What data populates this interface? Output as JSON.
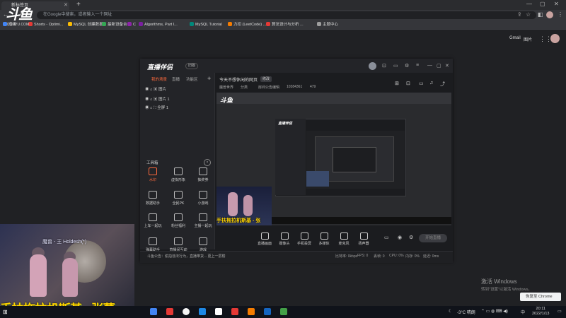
{
  "browser": {
    "tab_title": "新标签页",
    "omnibox_placeholder": "在Google中搜索，或者输入一个网址",
    "bookmarks": [
      {
        "label": "应用",
        "color": "#4285f4"
      },
      {
        "label": "Shorts - Optimi...",
        "color": "#e53935"
      },
      {
        "label": "MySQL 创建数据...",
        "color": "#fbbc04"
      },
      {
        "label": "最新设备台",
        "color": "#34a853"
      },
      {
        "label": "C",
        "color": "#8e24aa"
      },
      {
        "label": "Algorithms, Part I...",
        "color": "#7b1fa2"
      },
      {
        "label": "MySQL Tutorial",
        "color": "#00897b"
      },
      {
        "label": "力扣 (LeetCode) ...",
        "color": "#f57c00"
      },
      {
        "label": "算法设计与分析 ...",
        "color": "#e53935"
      },
      {
        "label": "主题中心",
        "color": "#9e9e9e"
      }
    ],
    "page_links": {
      "gmail": "Gmail",
      "images": "图片"
    }
  },
  "overlay_logo": {
    "text": "斗鱼",
    "sub": "DOUYU.COM"
  },
  "app": {
    "title": "直播伴侣",
    "version": "旧版",
    "left_tabs": [
      "我的场景",
      "直播",
      "功能区"
    ],
    "scenes": [
      "图片",
      "图片 1",
      "全屏 1"
    ],
    "toolbox_label": "工具箱",
    "tools": [
      {
        "label": "水印",
        "active": true
      },
      {
        "label": "虚拟形象",
        "active": false
      },
      {
        "label": "抽奖券",
        "active": false
      },
      {
        "label": "数据助手",
        "active": false
      },
      {
        "label": "全民PK",
        "active": false
      },
      {
        "label": "小游戏",
        "active": false
      },
      {
        "label": "上车一起玩",
        "active": false
      },
      {
        "label": "粉丝福利",
        "active": false
      },
      {
        "label": "主播一起玩",
        "active": false
      },
      {
        "label": "弹幕助手",
        "active": false
      },
      {
        "label": "直播间互动",
        "active": false
      },
      {
        "label": "游戏",
        "active": false
      }
    ],
    "stream_title": "今天不想休闲的网页",
    "edit_label": "修改",
    "meta": [
      "魔兽世界",
      "分类",
      "房间公告编辑",
      "10384361",
      "479"
    ],
    "preview_logo": "斗鱼",
    "inner_logo": "直播伴侣",
    "thumb_caption": "手扶拖拉机斯基 - 张",
    "controls": [
      "直播画面",
      "摄像头",
      "手机投屏",
      "多媒体",
      "麦克风",
      "扬声器"
    ],
    "go_live": "开始直播",
    "notice": "斗鱼公告：偷拍违法行为，直播带货...  更上一层楼",
    "stats": [
      "比特率: 0kbps",
      "FPS: 0",
      "丢帧: 0",
      "CPU: 0%",
      "内存: 0%",
      "延迟: 0ms"
    ]
  },
  "webcam": {
    "name": "魔兽 - 王 Holdesh(*)",
    "caption": "手扶拖拉机斯基 - 张蕾"
  },
  "windows": {
    "activate_title": "激活 Windows",
    "activate_sub": "转到\"设置\"以激活 Windows。",
    "restore_label": "恢复至 Chrome",
    "weather": "-3°C 晴朗",
    "ime": "中",
    "time": "20:11",
    "date": "2022/1/13",
    "taskbar_colors": [
      "#4285f4",
      "#e53935",
      "#f5f5f5",
      "#1e88e5",
      "#ffffff",
      "#e53935",
      "#f57c00",
      "#1565c0",
      "#43a047"
    ]
  }
}
